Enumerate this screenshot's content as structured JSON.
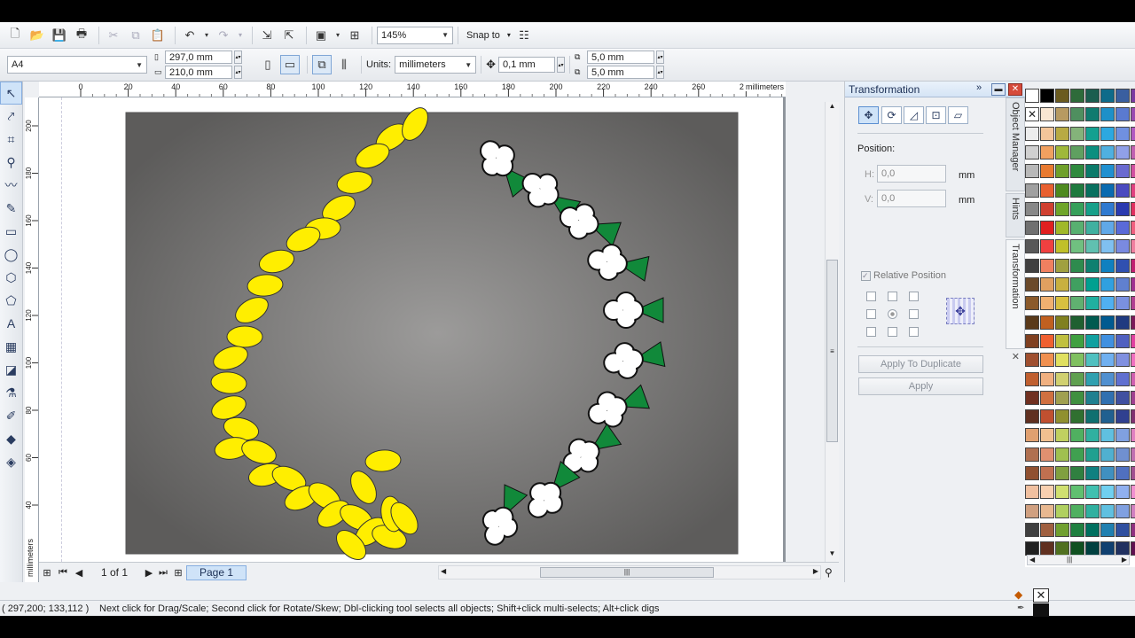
{
  "toolbar": {
    "zoom": "145%",
    "snap_label": "Snap to"
  },
  "propbar": {
    "page_size": "A4",
    "width": "297,0 mm",
    "height": "210,0 mm",
    "units_label": "Units:",
    "units": "millimeters",
    "nudge": "0,1 mm",
    "dup_x": "5,0 mm",
    "dup_y": "5,0 mm"
  },
  "ruler": {
    "unit": "millimeters",
    "h_ticks": [
      "0",
      "20",
      "40",
      "60",
      "80",
      "100",
      "120",
      "140",
      "160",
      "180",
      "200",
      "220",
      "240",
      "260",
      "280"
    ],
    "v_ticks": [
      "200",
      "180",
      "160",
      "140",
      "120",
      "100",
      "80",
      "60",
      "40"
    ]
  },
  "navigator": {
    "page_count": "1 of 1",
    "page_tab": "Page 1"
  },
  "docker": {
    "title": "Transformation",
    "position_label": "Position:",
    "h_label": "H:",
    "h_value": "0,0",
    "v_label": "V:",
    "v_value": "0,0",
    "unit": "mm",
    "relative_position": "Relative Position",
    "apply_duplicate": "Apply To Duplicate",
    "apply": "Apply",
    "side_tabs": [
      "Object Manager",
      "Hints",
      "Transformation"
    ]
  },
  "status": {
    "coords": "( 297,200; 133,112 )",
    "hint": "Next click for Drag/Scale; Second click for Rotate/Skew; Dbl-clicking tool selects all objects; Shift+click multi-selects; Alt+click digs"
  },
  "colors": {
    "leaf": "#ffee00",
    "leaf_stroke": "#333333",
    "green": "#11893a",
    "bg_center": "#9c9b9a",
    "bg_edge": "#5d5c5b"
  }
}
